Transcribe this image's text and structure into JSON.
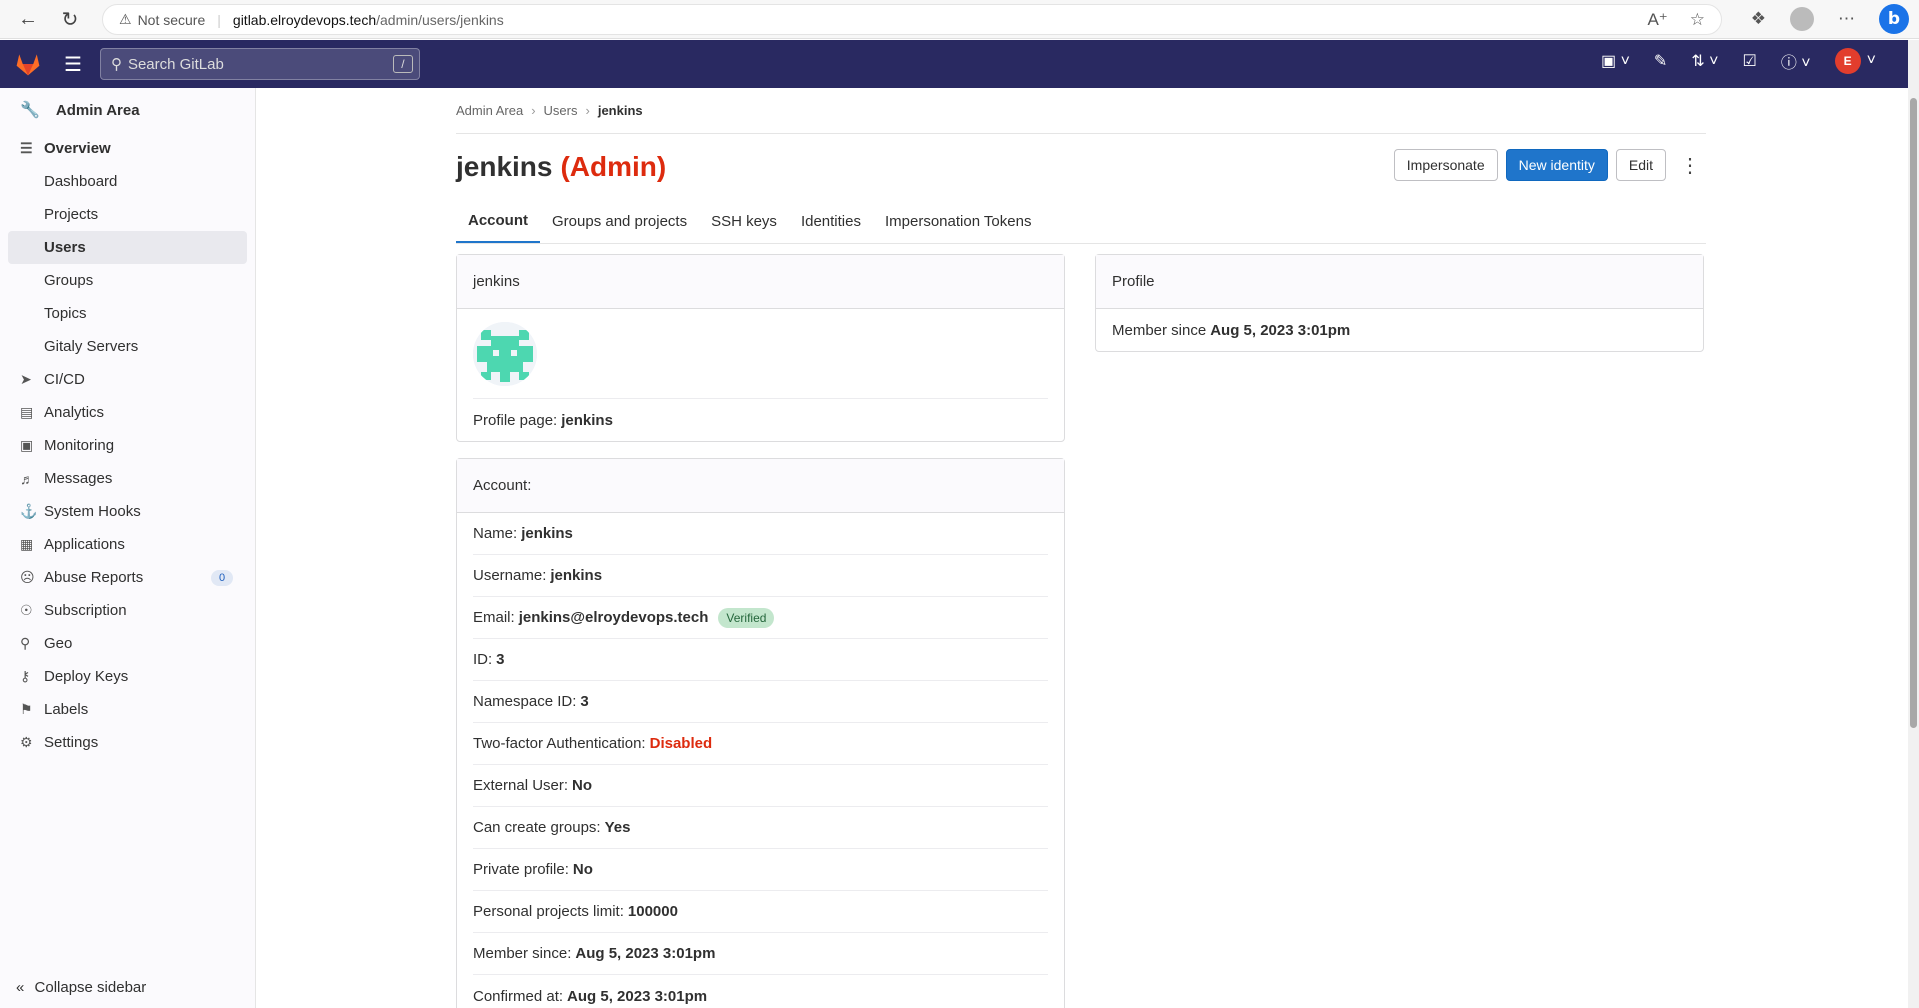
{
  "browser": {
    "not_secure": "Not secure",
    "url_host": "gitlab.elroydevops.tech",
    "url_path": "/admin/users/jenkins"
  },
  "topnav": {
    "search_placeholder": "Search GitLab",
    "search_shortcut": "/"
  },
  "sidebar": {
    "header": "Admin Area",
    "overview": "Overview",
    "overview_items": [
      "Dashboard",
      "Projects",
      "Users",
      "Groups",
      "Topics",
      "Gitaly Servers"
    ],
    "items": [
      {
        "label": "CI/CD",
        "icon": "rocket-icon"
      },
      {
        "label": "Analytics",
        "icon": "chart-icon"
      },
      {
        "label": "Monitoring",
        "icon": "monitor-icon"
      },
      {
        "label": "Messages",
        "icon": "bullhorn-icon"
      },
      {
        "label": "System Hooks",
        "icon": "hook-icon"
      },
      {
        "label": "Applications",
        "icon": "apps-icon"
      },
      {
        "label": "Abuse Reports",
        "icon": "abuse-icon",
        "badge": "0"
      },
      {
        "label": "Subscription",
        "icon": "subscription-icon"
      },
      {
        "label": "Geo",
        "icon": "location-icon"
      },
      {
        "label": "Deploy Keys",
        "icon": "key-icon"
      },
      {
        "label": "Labels",
        "icon": "label-icon"
      },
      {
        "label": "Settings",
        "icon": "gear-icon"
      }
    ],
    "collapse": "Collapse sidebar"
  },
  "breadcrumb": [
    "Admin Area",
    "Users",
    "jenkins"
  ],
  "page": {
    "title": "jenkins",
    "admin_tag": "(Admin)",
    "buttons": {
      "impersonate": "Impersonate",
      "new_identity": "New identity",
      "edit": "Edit"
    },
    "tabs": [
      "Account",
      "Groups and projects",
      "SSH keys",
      "Identities",
      "Impersonation Tokens"
    ]
  },
  "user_card": {
    "header": "jenkins",
    "profile_page_label": "Profile page:",
    "profile_page_value": "jenkins"
  },
  "account_card": {
    "header": "Account:",
    "rows": [
      {
        "label": "Name:",
        "value": "jenkins"
      },
      {
        "label": "Username:",
        "value": "jenkins"
      },
      {
        "label": "Email:",
        "value": "jenkins@elroydevops.tech",
        "badge": "Verified"
      },
      {
        "label": "ID:",
        "value": "3"
      },
      {
        "label": "Namespace ID:",
        "value": "3"
      },
      {
        "label": "Two-factor Authentication:",
        "value": "Disabled",
        "danger": true
      },
      {
        "label": "External User:",
        "value": "No"
      },
      {
        "label": "Can create groups:",
        "value": "Yes"
      },
      {
        "label": "Private profile:",
        "value": "No"
      },
      {
        "label": "Personal projects limit:",
        "value": "100000"
      },
      {
        "label": "Member since:",
        "value": "Aug 5, 2023 3:01pm"
      },
      {
        "label": "Confirmed at:",
        "value": "Aug 5, 2023 3:01pm"
      }
    ]
  },
  "profile_card": {
    "header": "Profile",
    "member_since_label": "Member since",
    "member_since_value": "Aug 5, 2023 3:01pm"
  },
  "colors": {
    "topnav": "#292961",
    "primary": "#1f75cb",
    "danger": "#dd2b0e"
  }
}
